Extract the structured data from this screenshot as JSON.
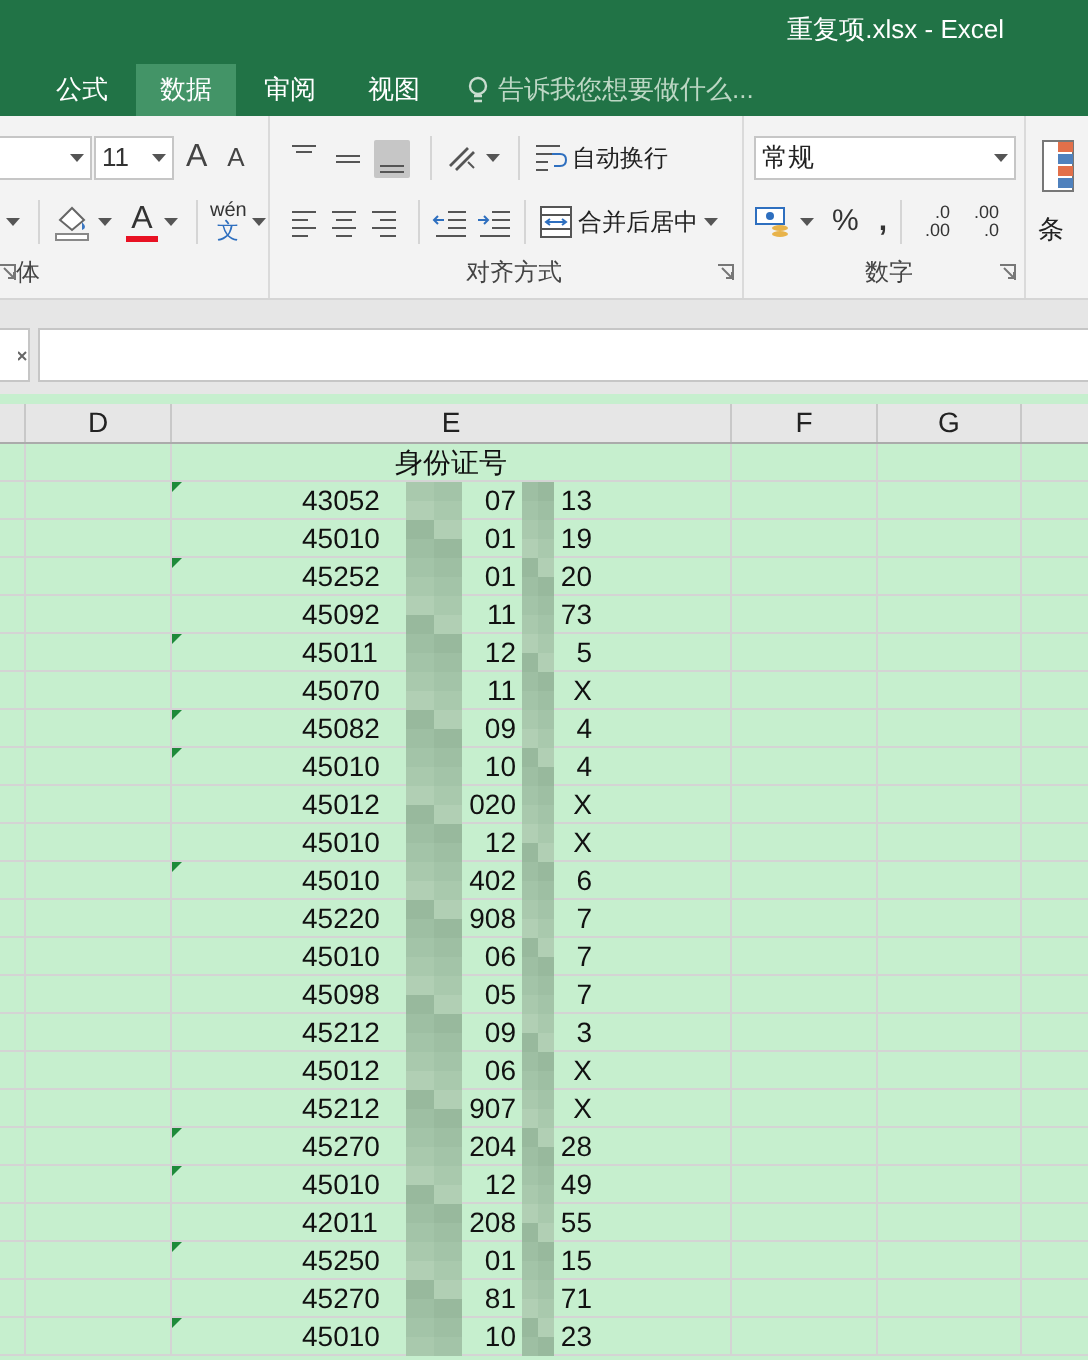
{
  "window": {
    "title": "重复项.xlsx - Excel"
  },
  "tabs": [
    {
      "label": "公式",
      "selected": false
    },
    {
      "label": "数据",
      "selected": true
    },
    {
      "label": "审阅",
      "selected": false
    },
    {
      "label": "视图",
      "selected": false
    }
  ],
  "tell_me": {
    "placeholder": "告诉我您想要做什么..."
  },
  "ribbon": {
    "font_size": "11",
    "grow_font": "A",
    "shrink_font": "A",
    "font_color": "A",
    "phonetic_top": "wén",
    "phonetic_bottom": "文",
    "vertical_align": [
      {
        "kind": "top",
        "selected": false
      },
      {
        "kind": "middle",
        "selected": false
      },
      {
        "kind": "bottom",
        "selected": true
      }
    ],
    "wrap_text": "自动换行",
    "merge_center": "合并后居中",
    "number_format": "常规",
    "percent": "%",
    "comma": ",",
    "increase_decimal": [
      ".0",
      ".00"
    ],
    "decrease_decimal": [
      ".00",
      ".0"
    ],
    "conditional_format": "条",
    "groups": [
      "体",
      "对齐方式",
      "数字"
    ]
  },
  "columns": [
    "D",
    "E",
    "F",
    "G"
  ],
  "sheet": {
    "header": "身份证号",
    "rows": [
      {
        "parts": [
          "43052",
          "07",
          "13"
        ],
        "flag": true
      },
      {
        "parts": [
          "45010",
          "01",
          "19"
        ],
        "flag": false
      },
      {
        "parts": [
          "45252",
          "01",
          "20"
        ],
        "flag": true
      },
      {
        "parts": [
          "45092",
          "11",
          "73"
        ],
        "flag": false
      },
      {
        "parts": [
          "45011",
          "12",
          "5"
        ],
        "flag": true
      },
      {
        "parts": [
          "45070",
          "11",
          "X"
        ],
        "flag": false
      },
      {
        "parts": [
          "45082",
          "09",
          "4"
        ],
        "flag": true
      },
      {
        "parts": [
          "45010",
          "10",
          "4"
        ],
        "flag": true
      },
      {
        "parts": [
          "45012",
          "020",
          "X"
        ],
        "flag": false
      },
      {
        "parts": [
          "45010",
          "12",
          "X"
        ],
        "flag": false
      },
      {
        "parts": [
          "45010",
          "402",
          "6"
        ],
        "flag": true
      },
      {
        "parts": [
          "45220",
          "908",
          "7"
        ],
        "flag": false
      },
      {
        "parts": [
          "45010",
          "06",
          "7"
        ],
        "flag": false
      },
      {
        "parts": [
          "45098",
          "05",
          "7"
        ],
        "flag": false
      },
      {
        "parts": [
          "45212",
          "09",
          "3"
        ],
        "flag": false
      },
      {
        "parts": [
          "45012",
          "06",
          "X"
        ],
        "flag": false
      },
      {
        "parts": [
          "45212",
          "907",
          "X"
        ],
        "flag": false
      },
      {
        "parts": [
          "45270",
          "204",
          "28"
        ],
        "flag": true
      },
      {
        "parts": [
          "45010",
          "12",
          "49"
        ],
        "flag": true
      },
      {
        "parts": [
          "42011",
          "208",
          "55"
        ],
        "flag": false
      },
      {
        "parts": [
          "45250",
          "01",
          "15"
        ],
        "flag": true
      },
      {
        "parts": [
          "45270",
          "81",
          "71"
        ],
        "flag": false
      },
      {
        "parts": [
          "45010",
          "10",
          "23"
        ],
        "flag": true
      }
    ]
  }
}
